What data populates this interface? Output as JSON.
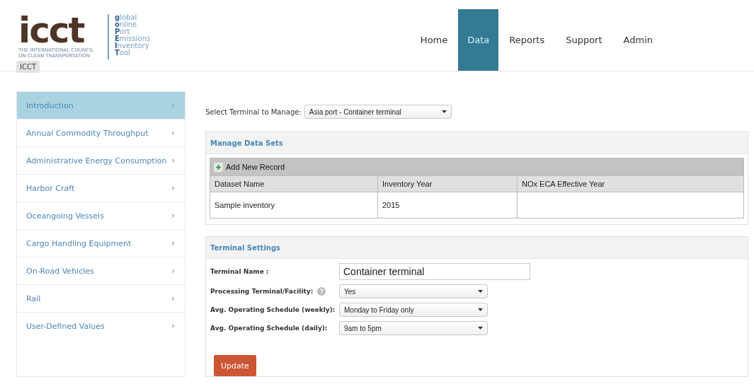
{
  "logo": {
    "wordmark": "icct",
    "tagline": "THE INTERNATIONAL COUNCIL ON CLEAN TRANSPORTATION",
    "tool_name": [
      "**g**lobal",
      "**o**nline",
      "**P**ort",
      "**E**missions",
      "**I**nventory",
      "**T**ool"
    ],
    "tooltip": "ICCT"
  },
  "nav": [
    {
      "label": "Home",
      "selected": false
    },
    {
      "label": "Data",
      "selected": true
    },
    {
      "label": "Reports",
      "selected": false
    },
    {
      "label": "Support",
      "selected": false
    },
    {
      "label": "Admin",
      "selected": false
    }
  ],
  "sidebar": {
    "items": [
      {
        "label": "Introduction",
        "chevron": "›",
        "selected": true
      },
      {
        "label": "Annual Commodity Throughput",
        "chevron": "›",
        "selected": false
      },
      {
        "label": "Administrative Energy Consumption",
        "chevron": "›",
        "selected": false
      },
      {
        "label": "Harbor Craft",
        "chevron": "›",
        "selected": false
      },
      {
        "label": "Oceangoing Vessels",
        "chevron": "›",
        "selected": false
      },
      {
        "label": "Cargo Handling Equipment",
        "chevron": "›",
        "selected": false
      },
      {
        "label": "On-Road Vehicles",
        "chevron": "›",
        "selected": false
      },
      {
        "label": "Rail",
        "chevron": "›",
        "selected": false
      },
      {
        "label": "User-Defined Values",
        "chevron": "›",
        "selected": false
      }
    ]
  },
  "terminal_select": {
    "label": "Select Terminal to Manage:",
    "value": "Asia port - Container terminal"
  },
  "data_sets": {
    "title": "Manage Data Sets",
    "add_button": "Add New Record",
    "columns": [
      "Dataset Name",
      "Inventory Year",
      "NOx ECA Effective Year"
    ],
    "rows": [
      [
        "Sample inventory",
        "2015",
        ""
      ]
    ]
  },
  "terminal_settings": {
    "title": "Terminal Settings",
    "fields": [
      {
        "kind": "text",
        "label": "Terminal Name :",
        "value": "Container terminal"
      },
      {
        "kind": "select",
        "label": "Processing Terminal/Facility:",
        "help": true,
        "value": "Yes"
      },
      {
        "kind": "select",
        "label": "Avg. Operating Schedule (weekly):",
        "value": "Monday to Friday only"
      },
      {
        "kind": "select",
        "label": "Avg. Operating Schedule (daily):",
        "value": "9am to 5pm"
      }
    ],
    "button": "Update"
  }
}
